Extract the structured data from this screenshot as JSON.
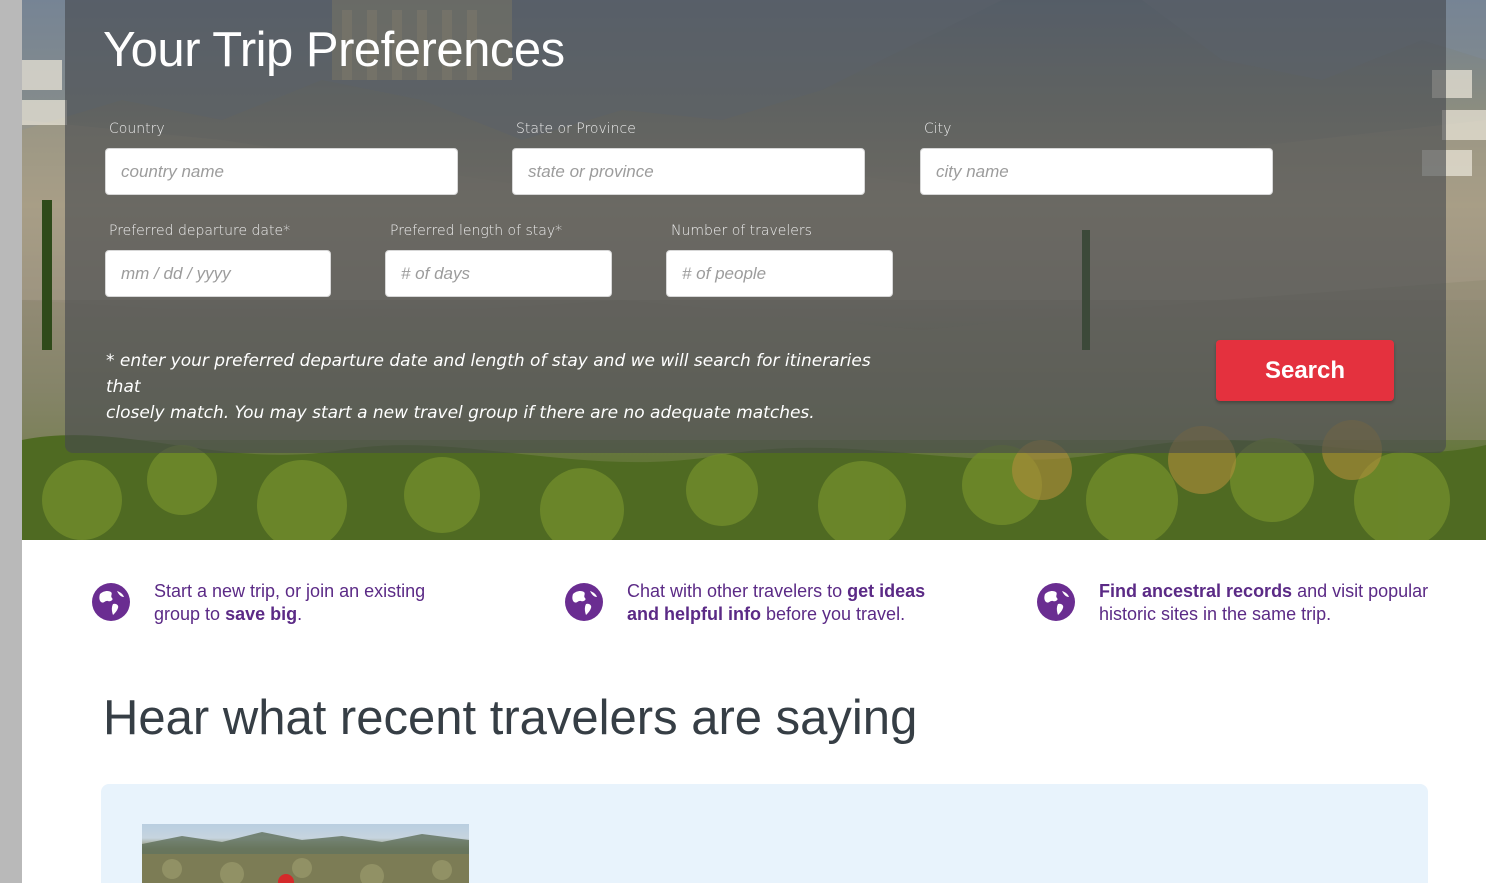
{
  "form": {
    "title": "Your Trip Preferences",
    "country_label": "Country",
    "country_placeholder": "country name",
    "state_label": "State or Province",
    "state_placeholder": "state or province",
    "city_label": "City",
    "city_placeholder": "city name",
    "date_label": "Preferred departure date*",
    "date_placeholder": "mm / dd / yyyy",
    "stay_label": "Preferred length of stay*",
    "stay_placeholder": "# of days",
    "travelers_label": "Number of travelers",
    "travelers_placeholder": "# of people",
    "note_line1": "* enter your preferred departure date and length of stay and we will search for itineraries that",
    "note_line2": "closely match. You may start a new travel group if there are no adequate matches.",
    "search_label": "Search"
  },
  "features": [
    {
      "icon": "globe-icon",
      "pre": "Start a new trip, or join an existing group to ",
      "bold": "save big",
      "post": "."
    },
    {
      "icon": "globe-icon",
      "pre": "Chat with other travelers to ",
      "bold": "get ideas and helpful info",
      "post": " before you travel."
    },
    {
      "icon": "globe-icon",
      "pre": "",
      "bold": "Find ancestral records",
      "post": " and visit popular historic sites in the same trip."
    }
  ],
  "testimonials": {
    "title": "Hear what recent travelers are saying"
  },
  "colors": {
    "accent_red": "#e4313e",
    "brand_purple": "#5b2a86",
    "heading_gray": "#363e45",
    "testimonial_bg": "#e8f3fc"
  }
}
